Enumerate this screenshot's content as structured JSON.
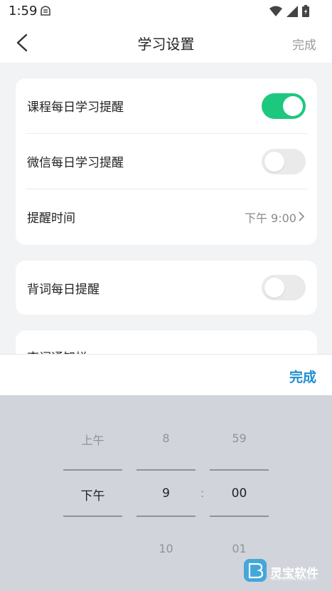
{
  "status_bar": {
    "time": "1:59",
    "icons": [
      "notification-icon",
      "wifi-icon",
      "signal-icon",
      "battery-icon"
    ]
  },
  "header": {
    "title": "学习设置",
    "done_label": "完成"
  },
  "settings": {
    "course_reminder": {
      "label": "课程每日学习提醒",
      "enabled": true
    },
    "wechat_reminder": {
      "label": "微信每日学习提醒",
      "enabled": false
    },
    "reminder_time": {
      "label": "提醒时间",
      "value": "下午 9:00"
    },
    "vocab_reminder": {
      "label": "背词每日提醒",
      "enabled": false
    },
    "partial_item": {
      "label": "查词通知栏"
    }
  },
  "sheet": {
    "done_label": "完成"
  },
  "picker": {
    "ampm": {
      "above": "上午",
      "selected": "下午"
    },
    "hour": {
      "above": "8",
      "selected": "9",
      "below": "10"
    },
    "separator": ":",
    "minute": {
      "above": "59",
      "selected": "00",
      "below": "01"
    }
  },
  "watermark": {
    "text": "灵宝软件",
    "url": "www.lbwtw.com"
  },
  "colors": {
    "accent_green": "#1dc87e",
    "accent_blue": "#1e8fd0",
    "picker_bg": "#d1d4db"
  }
}
